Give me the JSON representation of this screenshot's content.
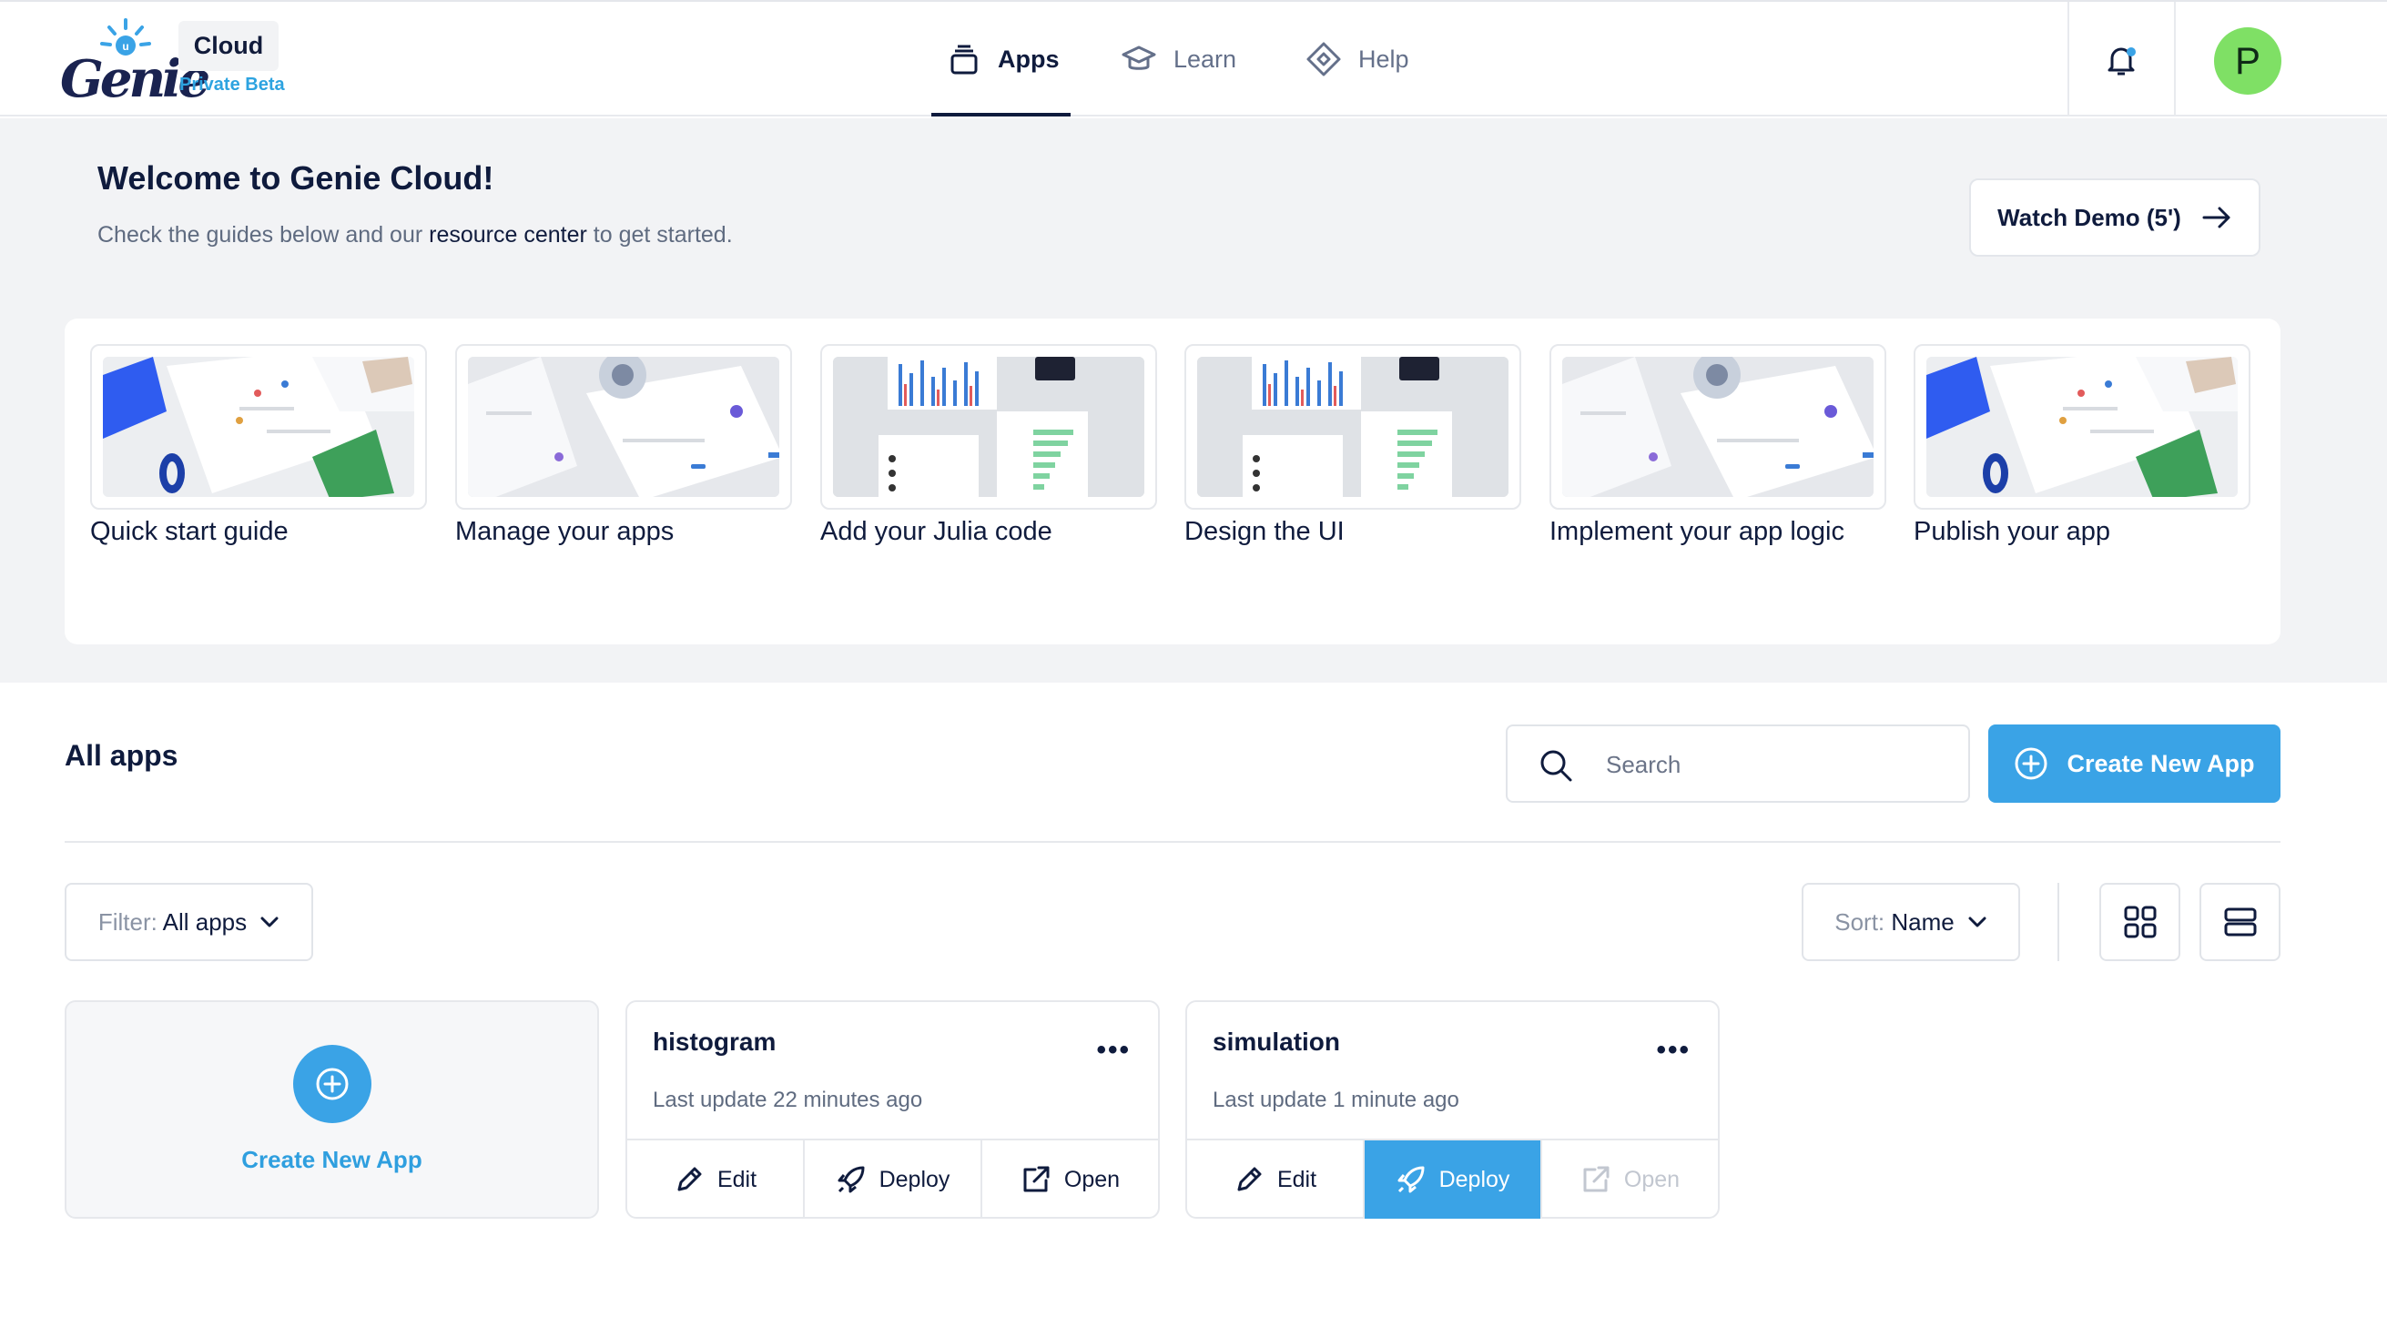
{
  "header": {
    "logo_text": "Genie",
    "product": "Cloud",
    "badge": "Private Beta",
    "nav": [
      {
        "label": "Apps",
        "icon": "stack-icon",
        "active": true
      },
      {
        "label": "Learn",
        "icon": "graduation-cap-icon",
        "active": false
      },
      {
        "label": "Help",
        "icon": "diamond-help-icon",
        "active": false
      }
    ],
    "notification_icon": "bell-icon",
    "avatar_initial": "P",
    "avatar_color": "#7fe065"
  },
  "welcome": {
    "title": "Welcome to Genie Cloud!",
    "subtitle_before": "Check the guides below and our ",
    "subtitle_link": "resource center",
    "subtitle_after": " to get started.",
    "watch_demo": "Watch Demo (5')"
  },
  "guides": [
    {
      "label": "Quick start guide"
    },
    {
      "label": "Manage your apps"
    },
    {
      "label": "Add your Julia code"
    },
    {
      "label": "Design the UI"
    },
    {
      "label": "Implement your app logic"
    },
    {
      "label": "Publish your app"
    }
  ],
  "apps_section": {
    "title": "All apps",
    "search_placeholder": "Search",
    "create_button": "Create New App",
    "filter_prefix": "Filter:",
    "filter_value": "All apps",
    "sort_prefix": "Sort:",
    "sort_value": "Name"
  },
  "new_app_card": {
    "label": "Create New App"
  },
  "apps": [
    {
      "name": "histogram",
      "updated": "Last update 22 minutes ago",
      "edit": "Edit",
      "deploy": "Deploy",
      "open": "Open"
    },
    {
      "name": "simulation",
      "updated": "Last update 1 minute ago",
      "edit": "Edit",
      "deploy": "Deploy",
      "open": "Open"
    }
  ],
  "colors": {
    "accent": "#3aa3e6",
    "navy": "#0f1b3d",
    "band": "#f2f3f5"
  }
}
